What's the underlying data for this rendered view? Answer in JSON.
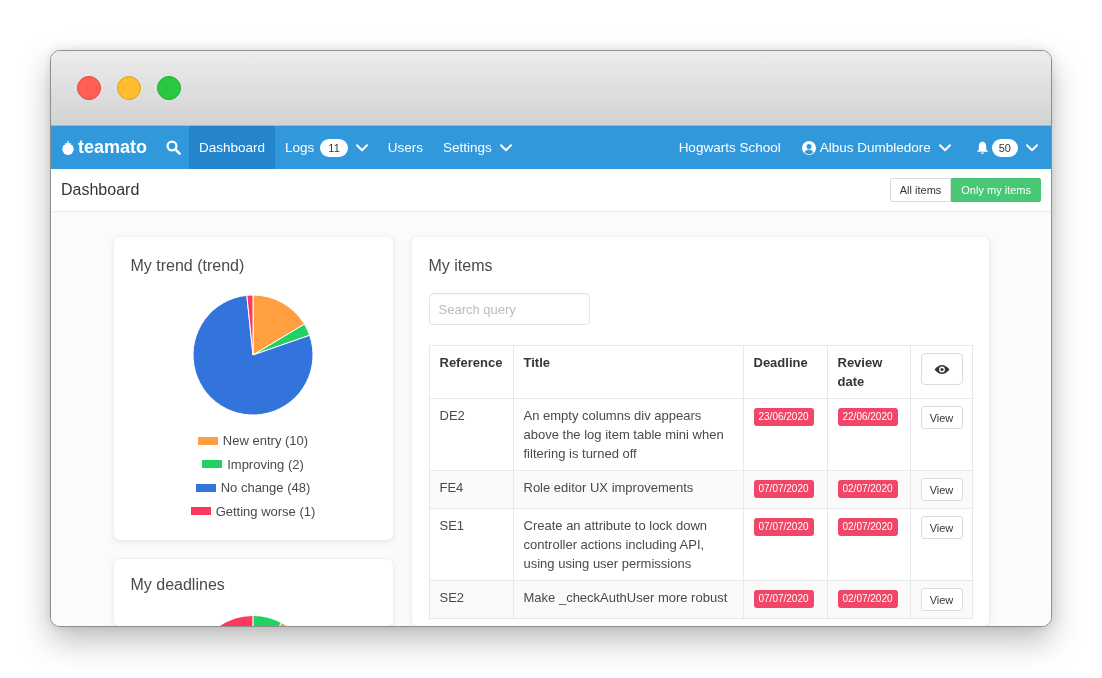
{
  "nav": {
    "brand": "teamato",
    "items": [
      {
        "label": "Dashboard",
        "selected": true,
        "dropdown": false
      },
      {
        "label": "Logs",
        "selected": false,
        "badge": "11",
        "dropdown": true
      },
      {
        "label": "Users",
        "selected": false,
        "dropdown": false
      },
      {
        "label": "Settings",
        "selected": false,
        "dropdown": true
      }
    ],
    "organization": "Hogwarts School",
    "user": "Albus Dumbledore",
    "notifications": "50"
  },
  "page_header": {
    "title": "Dashboard",
    "filters": [
      {
        "label": "All items",
        "selected": false
      },
      {
        "label": "Only my items",
        "selected": true
      }
    ]
  },
  "trend_card": {
    "chart_data": {
      "type": "pie",
      "title": "My trend (trend)",
      "categories": [
        "New entry (10)",
        "Improving (2)",
        "No change (48)",
        "Getting worse (1)"
      ],
      "values": [
        10,
        2,
        48,
        1
      ],
      "colors": [
        "#ff9f40",
        "#23d160",
        "#3273dc",
        "#ff3860"
      ]
    }
  },
  "deadlines_card": {
    "title": "My deadlines"
  },
  "items_card": {
    "title": "My items",
    "search": {
      "placeholder": "Search query"
    },
    "table": {
      "columns": [
        "Reference",
        "Title",
        "Deadline",
        "Review date"
      ],
      "rows": [
        {
          "reference": "DE2",
          "title": "An empty columns div appears above the log item table mini when filtering is turned off",
          "deadline": "23/06/2020",
          "review_date": "22/06/2020",
          "action": "View"
        },
        {
          "reference": "FE4",
          "title": "Role editor UX improvements",
          "deadline": "07/07/2020",
          "review_date": "02/07/2020",
          "action": "View"
        },
        {
          "reference": "SE1",
          "title": "Create an attribute to lock down controller actions including API, using using user permissions",
          "deadline": "07/07/2020",
          "review_date": "02/07/2020",
          "action": "View"
        },
        {
          "reference": "SE2",
          "title": "Make _checkAuthUser more robust",
          "deadline": "07/07/2020",
          "review_date": "02/07/2020",
          "action": "View"
        }
      ]
    }
  }
}
